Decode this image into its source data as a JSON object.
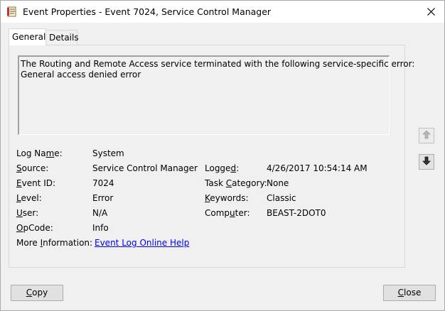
{
  "window": {
    "title": "Event Properties - Event 7024, Service Control Manager"
  },
  "tabs": [
    {
      "label": "General",
      "selected": true
    },
    {
      "label": "Details",
      "selected": false
    }
  ],
  "message": {
    "line1": "The Routing and Remote Access service terminated with the following service-specific error:",
    "line2": "General access denied error"
  },
  "fields": {
    "log_name": {
      "label_pre": "Log Na",
      "label_ul": "m",
      "label_post": "e:",
      "value": "System"
    },
    "source": {
      "label_pre": "",
      "label_ul": "S",
      "label_post": "ource:",
      "value": "Service Control Manager"
    },
    "event_id": {
      "label_pre": "",
      "label_ul": "E",
      "label_post": "vent ID:",
      "value": "7024"
    },
    "level": {
      "label_pre": "",
      "label_ul": "L",
      "label_post": "evel:",
      "value": "Error"
    },
    "user": {
      "label_pre": "",
      "label_ul": "U",
      "label_post": "ser:",
      "value": "N/A"
    },
    "opcode": {
      "label_pre": "",
      "label_ul": "O",
      "label_post": "pCode:",
      "value": "Info"
    },
    "more_info": {
      "label_pre": "More ",
      "label_ul": "I",
      "label_post": "nformation:",
      "value": "Event Log Online Help"
    },
    "logged": {
      "label_pre": "Logge",
      "label_ul": "d",
      "label_post": ":",
      "value": "4/26/2017 10:54:14 AM"
    },
    "task_category": {
      "label_pre": "Task ",
      "label_ul": "C",
      "label_post": "ategory:",
      "value": "None"
    },
    "keywords": {
      "label_pre": "",
      "label_ul": "K",
      "label_post": "eywords:",
      "value": "Classic"
    },
    "computer": {
      "label_pre": "Comp",
      "label_ul": "u",
      "label_post": "ter:",
      "value": "BEAST-2DOT0"
    }
  },
  "buttons": {
    "copy": {
      "label_pre": "",
      "label_ul": "C",
      "label_post": "opy"
    },
    "close": {
      "label_pre": "",
      "label_ul": "C",
      "label_post": "lose"
    }
  },
  "icons": {
    "title": "event-viewer-icon",
    "close": "close-icon",
    "up": "arrow-up-icon",
    "down": "arrow-down-icon"
  },
  "colors": {
    "link": "#0000ee",
    "window_bg": "#f0f0f0"
  }
}
